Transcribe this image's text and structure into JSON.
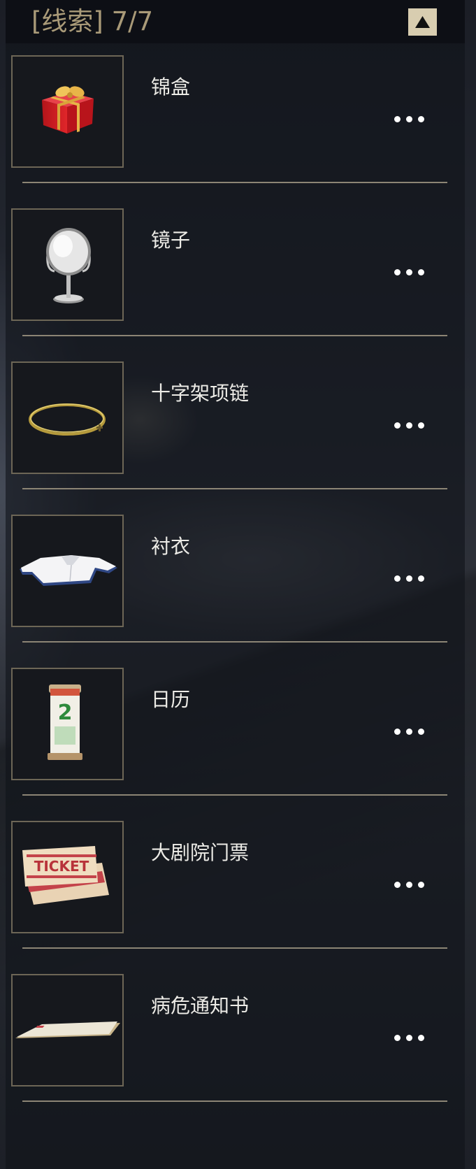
{
  "header": {
    "title": "[线索] 7/7",
    "collapse_icon": "triangle-up-icon"
  },
  "clues": [
    {
      "id": "gift-box",
      "name": "锦盒",
      "icon": "gift-box-icon"
    },
    {
      "id": "mirror",
      "name": "镜子",
      "icon": "mirror-icon"
    },
    {
      "id": "cross-necklace",
      "name": "十字架项链",
      "icon": "necklace-icon"
    },
    {
      "id": "shirt",
      "name": "衬衣",
      "icon": "shirt-icon"
    },
    {
      "id": "calendar",
      "name": "日历",
      "icon": "calendar-icon",
      "icon_text": "2"
    },
    {
      "id": "theater-ticket",
      "name": "大剧院门票",
      "icon": "ticket-icon",
      "icon_text": "TICKET"
    },
    {
      "id": "critical-notice",
      "name": "病危通知书",
      "icon": "paper-sheet-icon"
    }
  ],
  "colors": {
    "header_title": "#a99a78",
    "collapse_button": "#d8cdb0",
    "item_border": "#6d6656",
    "divider": "#8c8575",
    "item_text": "#ecebe6"
  }
}
